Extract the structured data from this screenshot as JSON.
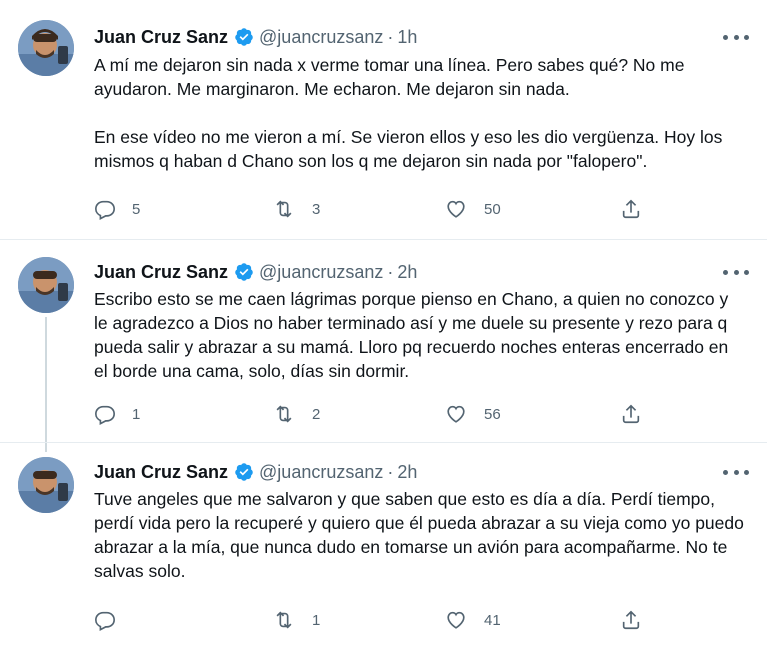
{
  "colors": {
    "text": "#0f1419",
    "muted": "#536471",
    "verified": "#1d9bf0",
    "divider": "#e6ecf0"
  },
  "tweets": [
    {
      "author": "Juan Cruz Sanz",
      "handle": "@juancruzsanz",
      "separator": "·",
      "time": "1h",
      "paragraphs": [
        "A mí me dejaron sin nada x verme tomar una línea. Pero sabes qué? No me ayudaron. Me marginaron. Me echaron. Me dejaron sin nada.",
        "En ese vídeo no me vieron a mí. Se vieron ellos y eso les dio vergüenza. Hoy los mismos q haban d Chano son los q me dejaron sin nada por \"falopero\"."
      ],
      "replies": "5",
      "retweets": "3",
      "likes": "50"
    },
    {
      "author": "Juan Cruz Sanz",
      "handle": "@juancruzsanz",
      "separator": "·",
      "time": "2h",
      "paragraphs": [
        "Escribo esto se me caen lágrimas porque pienso en Chano, a quien no conozco y le agradezco a Dios no haber terminado así y me duele su presente y rezo para q pueda salir y abrazar a su mamá. Lloro pq recuerdo noches enteras encerrado en el borde una cama, solo, días sin dormir."
      ],
      "replies": "1",
      "retweets": "2",
      "likes": "56"
    },
    {
      "author": "Juan Cruz Sanz",
      "handle": "@juancruzsanz",
      "separator": "·",
      "time": "2h",
      "paragraphs": [
        "Tuve angeles que me salvaron y que saben que esto es día a día. Perdí tiempo, perdí vida pero la recuperé y quiero que él pueda abrazar a su vieja como yo puedo abrazar a la mía, que nunca dudo en tomarse un avión para acompañarme. No te salvas solo."
      ],
      "replies": "",
      "retweets": "1",
      "likes": "41"
    }
  ],
  "icons": {
    "verified": "verified-badge-icon",
    "more": "more-options-icon",
    "reply": "reply-icon",
    "retweet": "retweet-icon",
    "like": "heart-icon",
    "share": "share-icon"
  }
}
